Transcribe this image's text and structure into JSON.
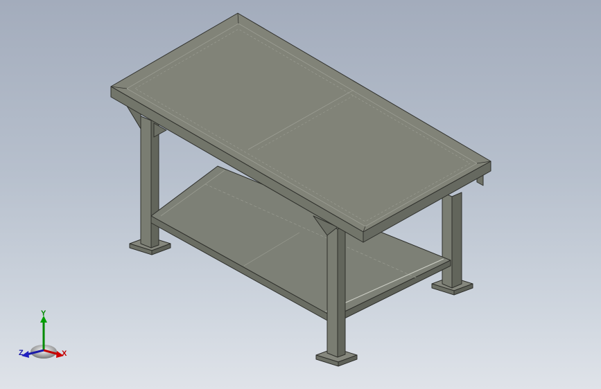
{
  "colors": {
    "background_top": "#a3acbc",
    "background_bottom": "#dfe3e9",
    "model_top": "#7f8177",
    "model_side": "#6f7267",
    "model_edge": "#2e2f2b",
    "axis_x": "#c00000",
    "axis_y": "#008a00",
    "axis_z": "#1a1aa8"
  },
  "triad": {
    "x_label": "X",
    "y_label": "Y",
    "z_label": "Z"
  }
}
